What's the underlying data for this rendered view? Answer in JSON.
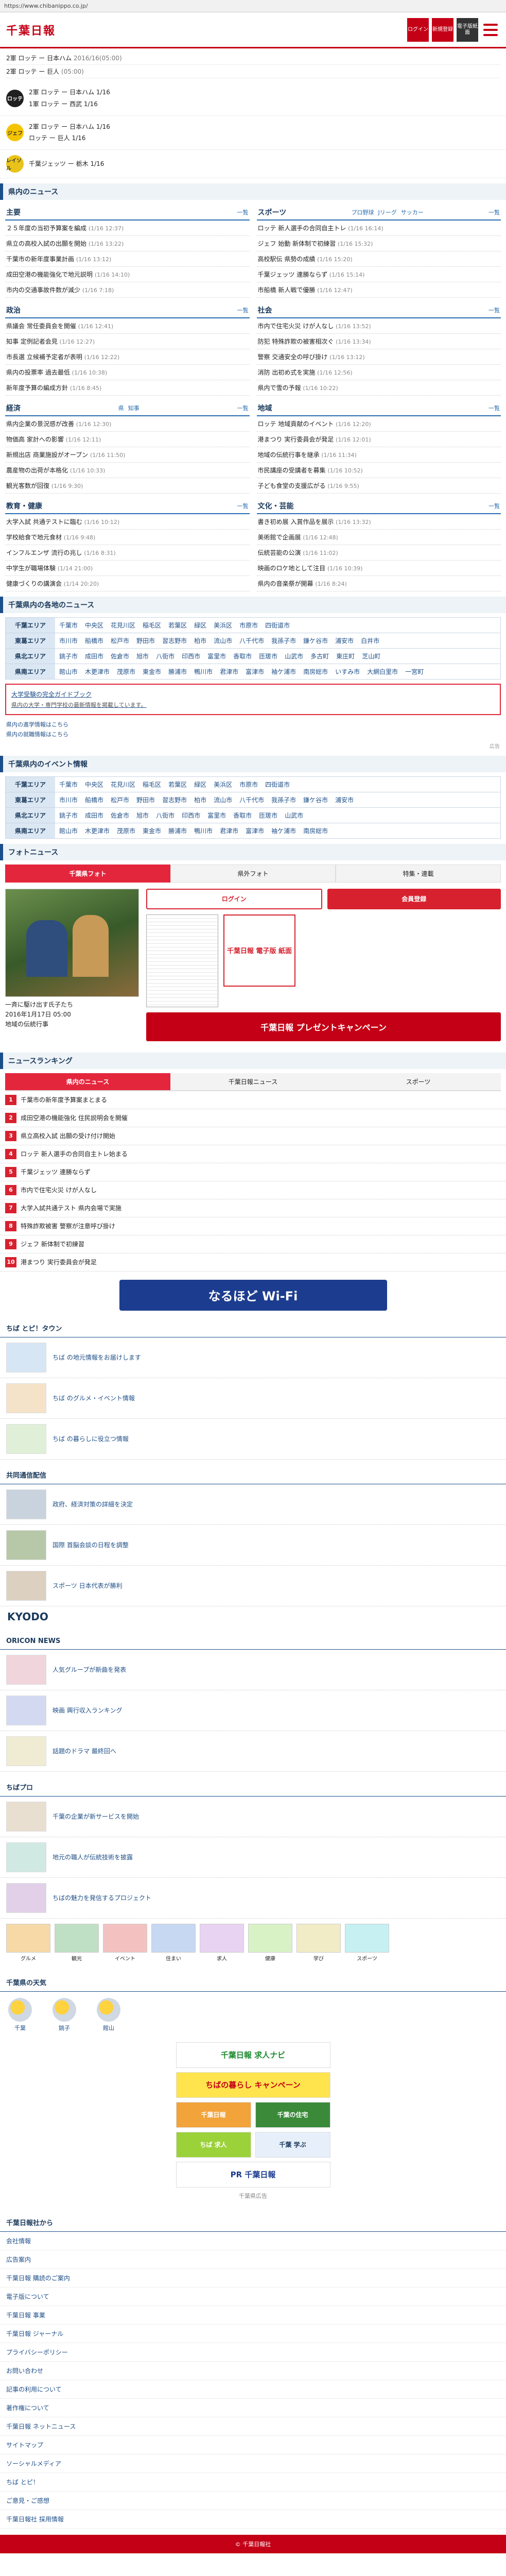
{
  "browser": {
    "url": "https://www.chibanippo.co.jp/"
  },
  "header": {
    "logo": "千葉日報",
    "btn_login": "ログイン",
    "btn_signup": "新規登録",
    "btn_epaper": "電子版紙面"
  },
  "schedule": [
    {
      "text": "2軍 ロッテ ー 日本ハム",
      "date": "2016/16(05:00)"
    },
    {
      "text": "2軍 ロッテ ー 巨人",
      "date": "(05:00)"
    }
  ],
  "teams": [
    {
      "name": "ロッテ",
      "color": "#1f1f1f",
      "lines": [
        "2軍 ロッテ ー 日本ハム 1/16",
        "1軍 ロッテ ー 西武 1/16"
      ]
    },
    {
      "name": "ジェフ",
      "color": "#f5c400",
      "lines": [
        "2軍 ロッテ ー 日本ハム 1/16",
        "ロッテ ー 巨人 1/16"
      ]
    },
    {
      "name": "レイソル",
      "color": "#e8c31a",
      "lines": [
        "千葉ジェッツ ー 栃木 1/16"
      ]
    }
  ],
  "local_news": {
    "section_title": "県内のニュース",
    "columns": [
      {
        "title": "主要",
        "more": "一覧",
        "items": [
          {
            "text": "２５年度の当初予算案を編成",
            "date": "(1/16 12:37)"
          },
          {
            "text": "県立の高校入試の出願を開始",
            "date": "(1/16 13:22)"
          },
          {
            "text": "千葉市の新年度事業計画",
            "date": "(1/16 13:12)"
          },
          {
            "text": "成田空港の機能強化で地元説明",
            "date": "(1/16 14:10)"
          },
          {
            "text": "市内の交通事故件数が減少",
            "date": "(1/16 7:18)"
          }
        ]
      },
      {
        "title": "スポーツ",
        "subs": [
          "プロ野球",
          "Jリーグ",
          "サッカー"
        ],
        "more": "一覧",
        "items": [
          {
            "text": "ロッテ 新人選手の合同自主トレ",
            "date": "(1/16 16:14)"
          },
          {
            "text": "ジェフ 始動 新体制で初練習",
            "date": "(1/16 15:32)"
          },
          {
            "text": "高校駅伝 県勢の成績",
            "date": "(1/16 15:20)"
          },
          {
            "text": "千葉ジェッツ 連勝ならず",
            "date": "(1/16 15:14)"
          },
          {
            "text": "市船橋 新人戦で優勝",
            "date": "(1/16 12:47)"
          }
        ]
      },
      {
        "title": "政治",
        "more": "一覧",
        "items": [
          {
            "text": "県議会 常任委員会を開催",
            "date": "(1/16 12:41)"
          },
          {
            "text": "知事 定例記者会見",
            "date": "(1/16 12:27)"
          },
          {
            "text": "市長選 立候補予定者が表明",
            "date": "(1/16 12:22)"
          },
          {
            "text": "県内の投票率 過去最低",
            "date": "(1/16 10:38)"
          },
          {
            "text": "新年度予算の編成方針",
            "date": "(1/16 8:45)"
          }
        ]
      },
      {
        "title": "社会",
        "more": "一覧",
        "items": [
          {
            "text": "市内で住宅火災 けが人なし",
            "date": "(1/16 13:52)"
          },
          {
            "text": "防犯 特殊詐欺の被害相次ぐ",
            "date": "(1/16 13:34)"
          },
          {
            "text": "警察 交通安全の呼び掛け",
            "date": "(1/16 13:12)"
          },
          {
            "text": "消防 出初め式を実施",
            "date": "(1/16 12:56)"
          },
          {
            "text": "県内で雪の予報",
            "date": "(1/16 10:22)"
          }
        ]
      },
      {
        "title": "経済",
        "subs": [
          "県",
          "知事"
        ],
        "more": "一覧",
        "items": [
          {
            "text": "県内企業の景況感が改善",
            "date": "(1/16 12:30)"
          },
          {
            "text": "物価高 家計への影響",
            "date": "(1/16 12:11)"
          },
          {
            "text": "新規出店 商業施設がオープン",
            "date": "(1/16 11:50)"
          },
          {
            "text": "農産物の出荷が本格化",
            "date": "(1/16 10:33)"
          },
          {
            "text": "観光客数が回復",
            "date": "(1/16 9:30)"
          }
        ]
      },
      {
        "title": "地域",
        "more": "一覧",
        "items": [
          {
            "text": "ロッテ 地域貢献のイベント",
            "date": "(1/16 12:20)"
          },
          {
            "text": "港まつり 実行委員会が発足",
            "date": "(1/16 12:01)"
          },
          {
            "text": "地域の伝統行事を継承",
            "date": "(1/16 11:34)"
          },
          {
            "text": "市民講座の受講者を募集",
            "date": "(1/16 10:52)"
          },
          {
            "text": "子ども食堂の支援広がる",
            "date": "(1/16 9:55)"
          }
        ]
      },
      {
        "title": "教育・健康",
        "more": "一覧",
        "items": [
          {
            "text": "大学入試 共通テストに臨む",
            "date": "(1/16 10:12)"
          },
          {
            "text": "学校給食で地元食材",
            "date": "(1/16 9:48)"
          },
          {
            "text": "インフルエンザ 流行の兆し",
            "date": "(1/16 8:31)"
          },
          {
            "text": "中学生が職場体験",
            "date": "(1/14 21:00)"
          },
          {
            "text": "健康づくりの講演会",
            "date": "(1/14 20:20)"
          }
        ]
      },
      {
        "title": "文化・芸能",
        "more": "一覧",
        "items": [
          {
            "text": "書き初め展 入賞作品を展示",
            "date": "(1/16 13:32)"
          },
          {
            "text": "美術館で企画展",
            "date": "(1/16 12:48)"
          },
          {
            "text": "伝統芸能の公演",
            "date": "(1/16 11:02)"
          },
          {
            "text": "映画のロケ地として注目",
            "date": "(1/16 10:39)"
          },
          {
            "text": "県内の音楽祭が開幕",
            "date": "(1/16 8:24)"
          }
        ]
      }
    ]
  },
  "areas": {
    "title": "千葉県内の各地のニュース",
    "rows": [
      {
        "label": "千葉エリア",
        "towns": [
          "千葉市",
          "中央区",
          "花見川区",
          "稲毛区",
          "若葉区",
          "緑区",
          "美浜区",
          "市原市",
          "四街道市"
        ]
      },
      {
        "label": "東葛エリア",
        "towns": [
          "市川市",
          "船橋市",
          "松戸市",
          "野田市",
          "習志野市",
          "柏市",
          "流山市",
          "八千代市",
          "我孫子市",
          "鎌ケ谷市",
          "浦安市",
          "白井市"
        ]
      },
      {
        "label": "県北エリア",
        "towns": [
          "銚子市",
          "成田市",
          "佐倉市",
          "旭市",
          "八街市",
          "印西市",
          "富里市",
          "香取市",
          "匝瑳市",
          "山武市",
          "多古町",
          "東庄町",
          "芝山町"
        ]
      },
      {
        "label": "県南エリア",
        "towns": [
          "館山市",
          "木更津市",
          "茂原市",
          "東金市",
          "勝浦市",
          "鴨川市",
          "君津市",
          "富津市",
          "袖ケ浦市",
          "南房総市",
          "いすみ市",
          "大網白里市",
          "一宮町"
        ]
      }
    ]
  },
  "notice": {
    "link": "大学受験の完全ガイドブック",
    "sub": "県内の大学・専門学校の最新情報を掲載しています。"
  },
  "small_links": [
    "県内の進学情報はこちら",
    "県内の就職情報はこちら"
  ],
  "ad_label": "広告",
  "events": {
    "title": "千葉県内のイベント情報",
    "rows": [
      {
        "label": "千葉エリア",
        "towns": [
          "千葉市",
          "中央区",
          "花見川区",
          "稲毛区",
          "若葉区",
          "緑区",
          "美浜区",
          "市原市",
          "四街道市"
        ]
      },
      {
        "label": "東葛エリア",
        "towns": [
          "市川市",
          "船橋市",
          "松戸市",
          "野田市",
          "習志野市",
          "柏市",
          "流山市",
          "八千代市",
          "我孫子市",
          "鎌ケ谷市",
          "浦安市"
        ]
      },
      {
        "label": "県北エリア",
        "towns": [
          "銚子市",
          "成田市",
          "佐倉市",
          "旭市",
          "八街市",
          "印西市",
          "富里市",
          "香取市",
          "匝瑳市",
          "山武市"
        ]
      },
      {
        "label": "県南エリア",
        "towns": [
          "館山市",
          "木更津市",
          "茂原市",
          "東金市",
          "勝浦市",
          "鴨川市",
          "君津市",
          "富津市",
          "袖ケ浦市",
          "南房総市"
        ]
      }
    ]
  },
  "photo": {
    "title": "フォトニュース",
    "tabs": [
      "千葉県フォト",
      "県外フォト",
      "特集・連載"
    ],
    "caption": "一斉に駆け出す氏子たち",
    "date": "2016年1月17日 05:00",
    "sub": "地域の伝統行事",
    "btn_login": "ログイン",
    "btn_register": "会員登録",
    "badge": "千葉日報 電子版 紙面",
    "promo": "千葉日報 プレゼントキャンペーン"
  },
  "ranking": {
    "title": "ニュースランキング",
    "tabs": [
      "県内のニュース",
      "千葉日報ニュース",
      "スポーツ"
    ],
    "items": [
      "千葉市の新年度予算案まとまる",
      "成田空港の機能強化 住民説明会を開催",
      "県立高校入試 出願の受け付け開始",
      "ロッテ 新人選手の合同自主トレ始まる",
      "千葉ジェッツ 連勝ならず",
      "市内で住宅火災 けが人なし",
      "大学入試共通テスト 県内会場で実施",
      "特殊詐欺被害 警察が注意呼び掛け",
      "ジェフ 新体制で初練習",
      "港まつり 実行委員会が発足"
    ]
  },
  "wifi": "なるほど Wi-Fi",
  "town": {
    "title": "ちば とピ！タウン",
    "items": [
      "ちば の地元情報をお届けします",
      "ちば のグルメ・イベント情報",
      "ちば の暮らしに役立つ情報"
    ]
  },
  "kyodo": {
    "title": "共同通信配信",
    "items": [
      "政府、経済対策の詳細を決定",
      "国際 首脳会談の日程を調整",
      "スポーツ 日本代表が勝利"
    ],
    "logo": "KYODO"
  },
  "oricon": {
    "title": "ORICON NEWS",
    "items": [
      "人気グループが新曲を発表",
      "映画 興行収入ランキング",
      "話題のドラマ 最終回へ"
    ]
  },
  "chibapro": {
    "title": "ちばプロ",
    "items": [
      "千葉の企業が新サービスを開始",
      "地元の職人が伝統技術を披露",
      "ちばの魅力を発信するプロジェクト"
    ],
    "tiles": [
      "グルメ",
      "観光",
      "イベント",
      "住まい",
      "求人",
      "健康",
      "学び",
      "スポーツ"
    ]
  },
  "weather": {
    "title": "千葉県の天気",
    "places": [
      "千葉",
      "銚子",
      "館山"
    ]
  },
  "ads": {
    "main": "千葉日報 求人ナビ",
    "second": "ちばの暮らし キャンペーン",
    "pairs": [
      [
        "千葉日報",
        "千葉の住宅"
      ],
      [
        "ちば 求人",
        "千葉 学ぶ"
      ]
    ],
    "last": "PR 千葉日報",
    "label": "千葉県広告"
  },
  "links": {
    "title": "千葉日報社から",
    "items": [
      "会社情報",
      "広告案内",
      "千葉日報 購読のご案内",
      "電子版について",
      "千葉日報 事業",
      "千葉日報 ジャーナル",
      "プライバシーポリシー",
      "お問い合わせ",
      "記事の利用について",
      "著作権について",
      "千葉日報 ネットニュース",
      "サイトマップ",
      "ソーシャルメディア",
      "ちば とピ！",
      "ご意見・ご感想",
      "千葉日報社 採用情報"
    ]
  },
  "footer": "© 千葉日報社"
}
